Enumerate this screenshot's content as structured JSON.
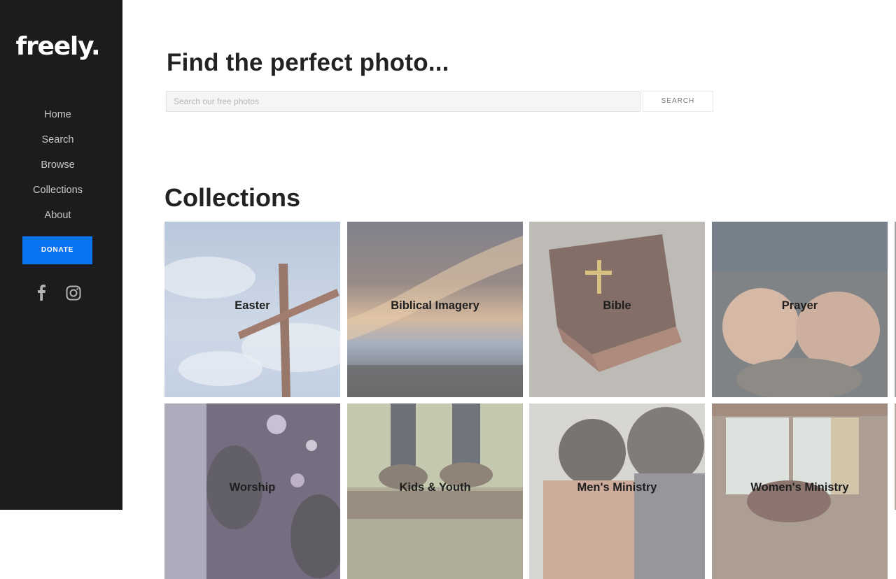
{
  "brand": {
    "logo": "freely."
  },
  "nav": {
    "items": [
      {
        "label": "Home"
      },
      {
        "label": "Search"
      },
      {
        "label": "Browse"
      },
      {
        "label": "Collections"
      },
      {
        "label": "About"
      }
    ],
    "donate_label": "DONATE"
  },
  "social": {
    "icons": [
      "facebook-icon",
      "instagram-icon"
    ]
  },
  "hero": {
    "title": "Find the perfect photo...",
    "search_placeholder": "Search our free photos",
    "search_value": "",
    "search_button": "SEARCH"
  },
  "collections": {
    "title": "Collections",
    "items": [
      {
        "label": "Easter"
      },
      {
        "label": "Biblical Imagery"
      },
      {
        "label": "Bible"
      },
      {
        "label": "Prayer"
      },
      {
        "label": "Worship"
      },
      {
        "label": "Kids & Youth"
      },
      {
        "label": "Men's Ministry"
      },
      {
        "label": "Women's Ministry"
      }
    ]
  },
  "colors": {
    "sidebar": "#1c1c1c",
    "accent": "#0a74f0",
    "text_dark": "#222222"
  }
}
